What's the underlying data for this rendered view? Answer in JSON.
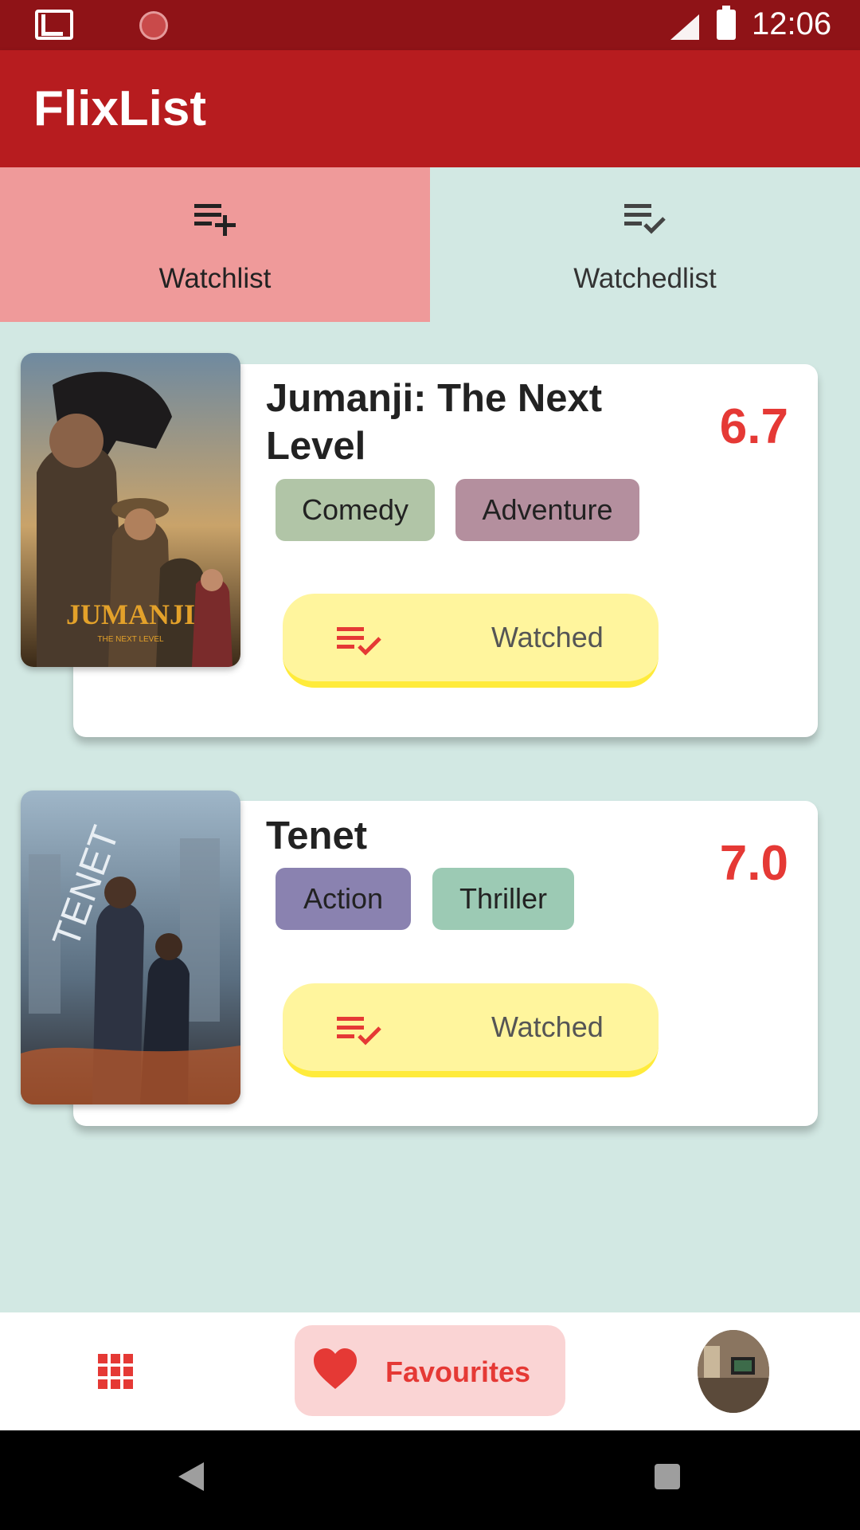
{
  "status_bar": {
    "time": "12:06",
    "icons": [
      "gmail-icon",
      "sync-icon",
      "signal-icon",
      "battery-icon"
    ]
  },
  "app_bar": {
    "title": "FlixList"
  },
  "tabs": [
    {
      "label": "Watchlist",
      "icon": "playlist-add-icon",
      "active": true
    },
    {
      "label": "Watchedlist",
      "icon": "playlist-check-icon",
      "active": false
    }
  ],
  "movies": [
    {
      "title": "Jumanji: The Next Level",
      "rating": "6.7",
      "genres": [
        {
          "label": "Comedy",
          "color": "#b1c5a7"
        },
        {
          "label": "Adventure",
          "color": "#b48f9e"
        }
      ],
      "action_label": "Watched",
      "poster": "jumanji-poster"
    },
    {
      "title": "Tenet",
      "rating": "7.0",
      "genres": [
        {
          "label": "Action",
          "color": "#8a82b0"
        },
        {
          "label": "Thriller",
          "color": "#9ccab4"
        }
      ],
      "action_label": "Watched",
      "poster": "tenet-poster"
    }
  ],
  "bottom_nav": {
    "items": [
      {
        "name": "grid-icon"
      },
      {
        "name": "favourites",
        "label": "Favourites",
        "selected": true
      },
      {
        "name": "profile-avatar"
      }
    ]
  },
  "colors": {
    "status_bar": "#8f1317",
    "app_bar": "#b71c1f",
    "tab_active": "#ef9a9a",
    "background": "#d2e8e3",
    "rating": "#e53935",
    "watched_button": "#fff59d",
    "favourites_pill": "#fad4d4"
  }
}
